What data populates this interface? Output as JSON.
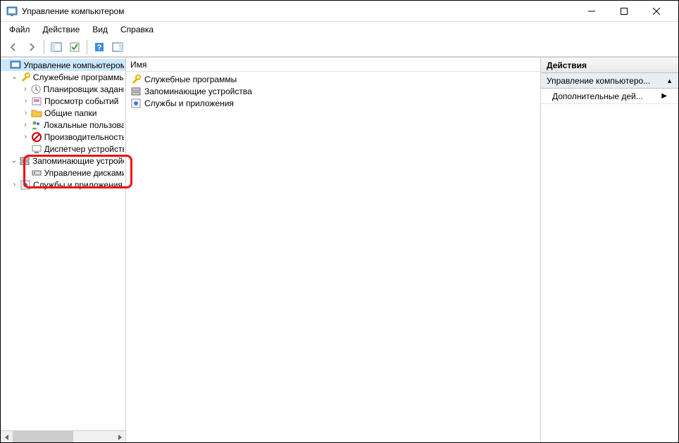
{
  "title": "Управление компьютером",
  "menu": [
    "Файл",
    "Действие",
    "Вид",
    "Справка"
  ],
  "tree": {
    "root": "Управление компьютером (л",
    "g1": "Служебные программы",
    "g1_items": [
      "Планировщик заданий",
      "Просмотр событий",
      "Общие папки",
      "Локальные пользоват",
      "Производительность",
      "Диспетчер устройств"
    ],
    "g2": "Запоминающие устройст",
    "g2_item": "Управление дисками",
    "g3": "Службы и приложения"
  },
  "list": {
    "header": "Имя",
    "items": [
      "Служебные программы",
      "Запоминающие устройства",
      "Службы и приложения"
    ]
  },
  "actions": {
    "header": "Действия",
    "section": "Управление компьютеро...",
    "more": "Дополнительные дей..."
  }
}
